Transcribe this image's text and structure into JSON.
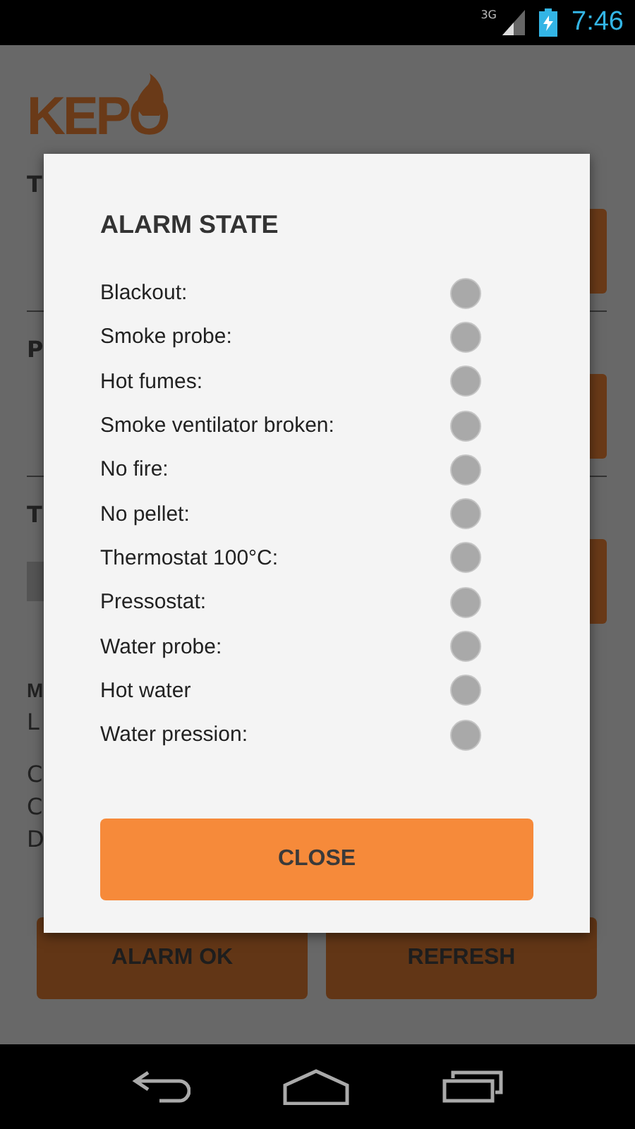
{
  "status_bar": {
    "network": "3G",
    "time": "7:46"
  },
  "logo": {
    "text": "KEPO"
  },
  "sections": [
    {
      "label": "T",
      "kind": "button"
    },
    {
      "label": "P",
      "kind": "button"
    },
    {
      "label": "T",
      "kind": "slider"
    }
  ],
  "info": {
    "title": "M",
    "lines": [
      "L"
    ]
  },
  "details": [
    "C",
    "C",
    "D"
  ],
  "buttons": [
    "ALARM OK",
    "REFRESH"
  ],
  "dialog": {
    "title": "ALARM STATE",
    "alarms": [
      {
        "label": "Blackout:",
        "on": false
      },
      {
        "label": "Smoke probe:",
        "on": false
      },
      {
        "label": "Hot fumes:",
        "on": false
      },
      {
        "label": "Smoke ventilator broken:",
        "on": false
      },
      {
        "label": "No fire:",
        "on": false
      },
      {
        "label": "No pellet:",
        "on": false
      },
      {
        "label": "Thermostat 100°C:",
        "on": false
      },
      {
        "label": "Pressostat:",
        "on": false
      },
      {
        "label": "Water probe:",
        "on": false
      },
      {
        "label": "Hot water",
        "on": false
      },
      {
        "label": "Water pression:",
        "on": false
      }
    ],
    "close_button": "CLOSE"
  }
}
